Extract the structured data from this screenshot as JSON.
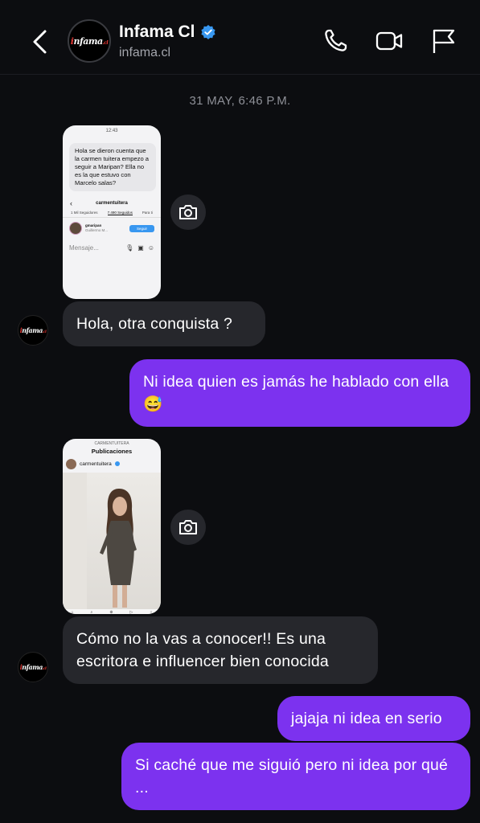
{
  "header": {
    "contact_name": "Infama Cl",
    "handle": "infama.cl",
    "logo_text": "infama.cl",
    "icons": [
      "back-chevron-icon",
      "verified-badge-icon",
      "phone-icon",
      "video-icon",
      "flag-icon"
    ]
  },
  "conversation": {
    "timestamp": "31 MAY, 6:46 P.M.",
    "screenshot1": {
      "status_time": "12:43",
      "bubble_text": "Hola se dieron cuenta que la carmen tuitera empezo a seguir a Maripan? Ella no es la que estuvo con Marcelo salas?",
      "profile_username": "carmentuitera",
      "tabs": [
        "1 Mil Seguidores",
        "7.490 Seguidos",
        "Para ti"
      ],
      "follow_name": "gmaripan",
      "follow_sub": "Guillermo M...",
      "follow_button": "Seguir",
      "input_placeholder": "Mensaje..."
    },
    "screenshot2": {
      "top_sub": "CARMENTUITERA",
      "top_title": "Publicaciones",
      "username": "carmentuitera"
    },
    "messages": [
      {
        "side": "in",
        "text": "Hola, otra conquista ?"
      },
      {
        "side": "out",
        "text": "Ni idea quien es jamás he hablado con ella 😅"
      },
      {
        "side": "in",
        "text": "Cómo no la vas a conocer!! Es una escritora e influencer bien conocida"
      },
      {
        "side": "out",
        "text": "jajaja ni idea en serio"
      },
      {
        "side": "out",
        "text": "Si caché que me siguió pero ni idea por qué ..."
      }
    ]
  },
  "colors": {
    "background": "#0c0d10",
    "incoming_bubble": "#26272c",
    "outgoing_bubble": "#7c32ef",
    "verified_badge": "#3897f0",
    "logo_accent": "#e53935"
  }
}
